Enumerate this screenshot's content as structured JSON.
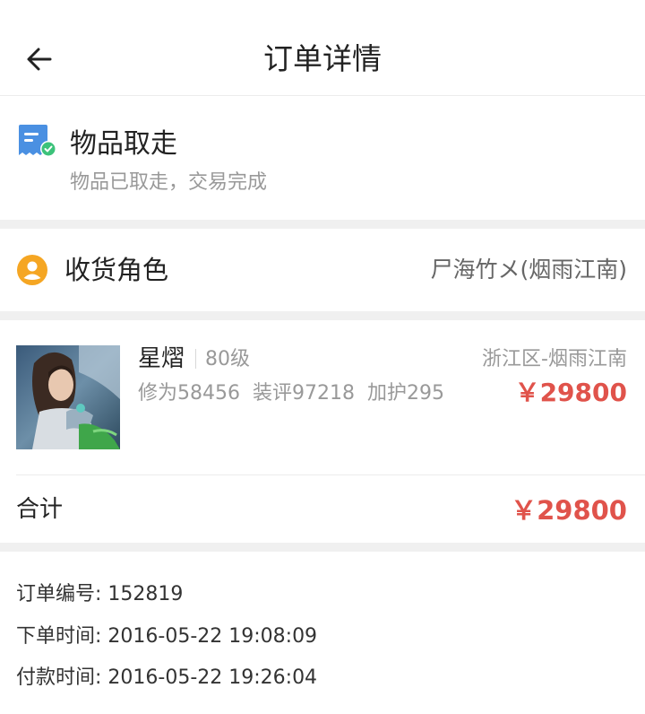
{
  "header": {
    "title": "订单详情",
    "back_icon": "arrow-left-icon"
  },
  "status": {
    "title": "物品取走",
    "subtitle": "物品已取走，交易完成",
    "icon": "receipt-check-icon",
    "icon_color": "#4a90e2",
    "check_color": "#3cc27a"
  },
  "receiver": {
    "label": "收货角色",
    "value": "尸海竹メ(烟雨江南)",
    "icon": "user-circle-icon",
    "icon_color": "#f5a623"
  },
  "item": {
    "name": "星熠",
    "level": "80级",
    "stats": [
      "修为58456",
      "装评97218",
      "加护295"
    ],
    "server": "浙江区-烟雨江南",
    "price": "￥29800"
  },
  "total": {
    "label": "合计",
    "price": "￥29800"
  },
  "order_info": {
    "order_number": "订单编号: 152819",
    "order_time": "下单时间: 2016-05-22 19:08:09",
    "pay_time": "付款时间: 2016-05-22 19:26:04"
  },
  "colors": {
    "price_red": "#e0534b",
    "separator": "#f0f0f0"
  }
}
